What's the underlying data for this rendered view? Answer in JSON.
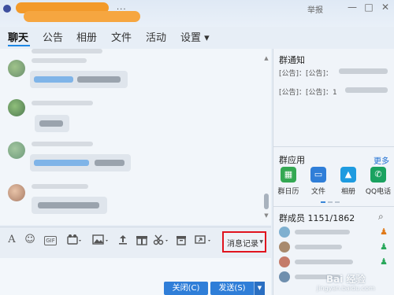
{
  "window": {
    "title_suffix": "...",
    "report_label": "举报",
    "minimize_glyph": "—",
    "maximize_glyph": "□",
    "close_glyph": "✕"
  },
  "tabs": [
    {
      "label": "聊天",
      "active": true
    },
    {
      "label": "公告"
    },
    {
      "label": "相册"
    },
    {
      "label": "文件"
    },
    {
      "label": "活动"
    },
    {
      "label": "设置 ▾"
    }
  ],
  "toolbar": {
    "font_glyph": "A",
    "emoji_glyph": "☺",
    "gif_label": "GIF",
    "record_label": "消息记录",
    "record_arrow": "▼"
  },
  "actions": {
    "close_label": "关闭(C)",
    "send_label": "发送(S)",
    "send_arrow": "▼"
  },
  "notice": {
    "title": "群通知",
    "line1_prefix": "[公告]：[公告]：",
    "line2_prefix": "[公告]：[公告]：1"
  },
  "apps": {
    "title": "群应用",
    "more": "更多",
    "items": [
      {
        "label": "群日历",
        "icon": "calendar-icon",
        "color": "#34a853"
      },
      {
        "label": "文件",
        "icon": "folder-icon",
        "color": "#2f7ed8"
      },
      {
        "label": "相册",
        "icon": "photo-icon",
        "color": "#1e9be0"
      },
      {
        "label": "QQ电话",
        "icon": "phone-icon",
        "color": "#1aa260"
      }
    ]
  },
  "members": {
    "title": "群成员 1151/1862"
  },
  "watermark": {
    "text": "Bai 经验",
    "url": "jingyan.baidu.com"
  },
  "colors": {
    "accent": "#2f7ed8",
    "highlight_border": "#e0141e"
  }
}
